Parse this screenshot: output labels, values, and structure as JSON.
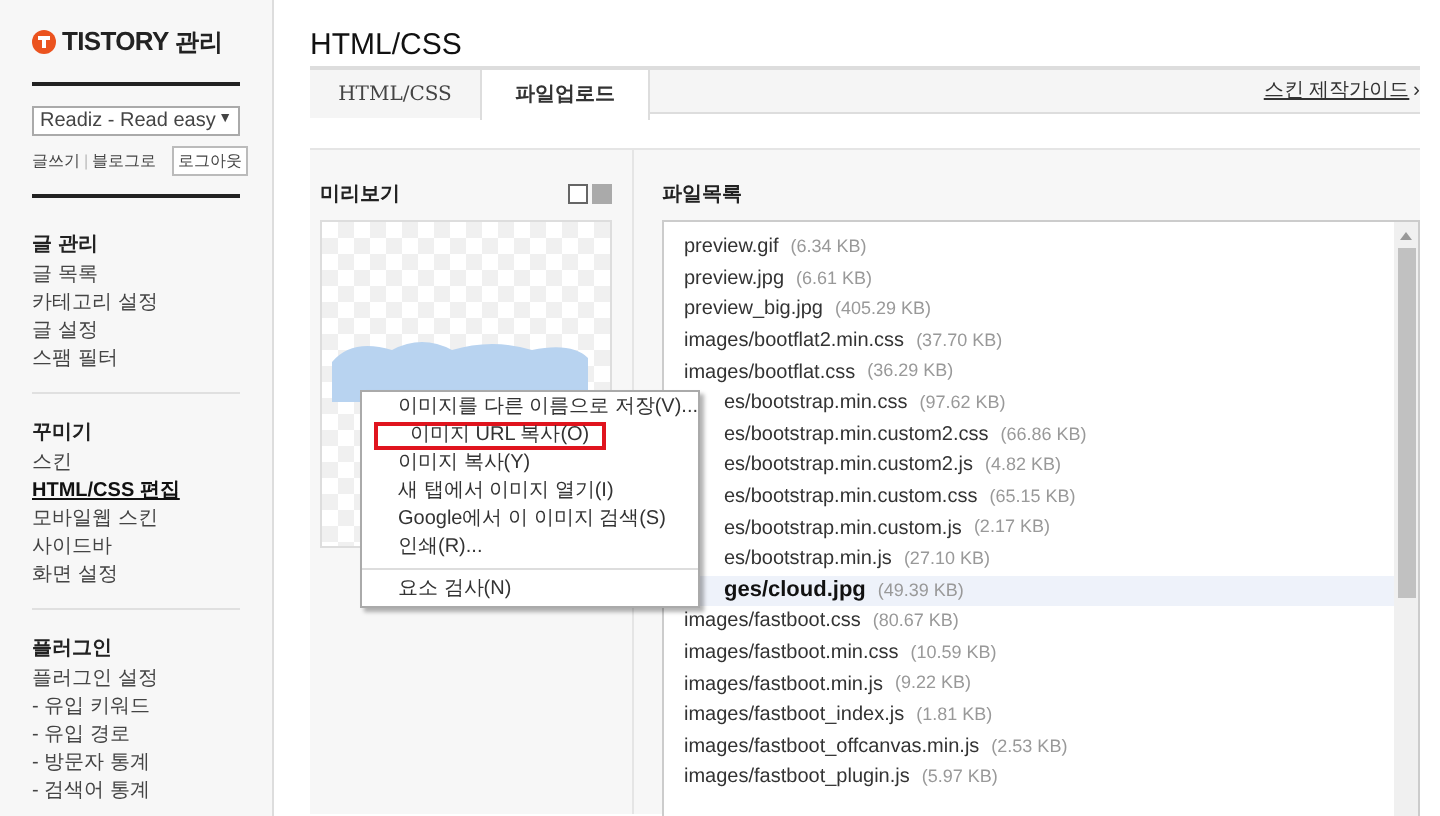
{
  "sidebar": {
    "logo": "TISTORY",
    "logo_suffix": "관리",
    "blog_select": "Readiz - Read easy",
    "select_arrow": "▼",
    "links": [
      "글쓰기",
      "블로그로"
    ],
    "link_separator": "|",
    "logout": "로그아웃",
    "sections": [
      {
        "heading": "글 관리",
        "items": [
          {
            "label": "글 목록",
            "selected": false
          },
          {
            "label": "카테고리 설정",
            "selected": false
          },
          {
            "label": "글 설정",
            "selected": false
          },
          {
            "label": "스팸 필터",
            "selected": false
          }
        ]
      },
      {
        "heading": "꾸미기",
        "items": [
          {
            "label": "스킨",
            "selected": false
          },
          {
            "label": "HTML/CSS 편집",
            "selected": true
          },
          {
            "label": "모바일웹 스킨",
            "selected": false
          },
          {
            "label": "사이드바",
            "selected": false
          },
          {
            "label": "화면 설정",
            "selected": false
          }
        ]
      },
      {
        "heading": "플러그인",
        "items": [
          {
            "label": "플러그인 설정",
            "selected": false
          },
          {
            "label": "- 유입 키워드",
            "selected": false
          },
          {
            "label": "- 유입 경로",
            "selected": false
          },
          {
            "label": "- 방문자 통계",
            "selected": false
          },
          {
            "label": "- 검색어 통계",
            "selected": false
          }
        ]
      }
    ]
  },
  "page_title": "HTML/CSS",
  "tabs": [
    {
      "label": "HTML/CSS",
      "selected": false
    },
    {
      "label": "파일업로드",
      "selected": true
    }
  ],
  "guide_link": "스킨 제작가이드",
  "guide_arrow": "›",
  "preview": {
    "title": "미리보기"
  },
  "file_list": {
    "title": "파일목록",
    "files": [
      {
        "name": "preview.gif",
        "size": "(6.34 KB)",
        "selected": false,
        "partial": false
      },
      {
        "name": "preview.jpg",
        "size": "(6.61 KB)",
        "selected": false,
        "partial": false
      },
      {
        "name": "preview_big.jpg",
        "size": "(405.29 KB)",
        "selected": false,
        "partial": false
      },
      {
        "name": "images/bootflat2.min.css",
        "size": "(37.70 KB)",
        "selected": false,
        "partial": false
      },
      {
        "name": "images/bootflat.css",
        "size": "(36.29 KB)",
        "selected": false,
        "partial": false
      },
      {
        "name": "es/bootstrap.min.css",
        "size": "(97.62 KB)",
        "selected": false,
        "partial": true
      },
      {
        "name": "es/bootstrap.min.custom2.css",
        "size": "(66.86 KB)",
        "selected": false,
        "partial": true
      },
      {
        "name": "es/bootstrap.min.custom2.js",
        "size": "(4.82 KB)",
        "selected": false,
        "partial": true
      },
      {
        "name": "es/bootstrap.min.custom.css",
        "size": "(65.15 KB)",
        "selected": false,
        "partial": true
      },
      {
        "name": "es/bootstrap.min.custom.js",
        "size": "(2.17 KB)",
        "selected": false,
        "partial": true
      },
      {
        "name": "es/bootstrap.min.js",
        "size": "(27.10 KB)",
        "selected": false,
        "partial": true
      },
      {
        "name": "ges/cloud.jpg",
        "size": "(49.39 KB)",
        "selected": true,
        "partial": true
      },
      {
        "name": "images/fastboot.css",
        "size": "(80.67 KB)",
        "selected": false,
        "partial": false
      },
      {
        "name": "images/fastboot.min.css",
        "size": "(10.59 KB)",
        "selected": false,
        "partial": false
      },
      {
        "name": "images/fastboot.min.js",
        "size": "(9.22 KB)",
        "selected": false,
        "partial": false
      },
      {
        "name": "images/fastboot_index.js",
        "size": "(1.81 KB)",
        "selected": false,
        "partial": false
      },
      {
        "name": "images/fastboot_offcanvas.min.js",
        "size": "(2.53 KB)",
        "selected": false,
        "partial": false
      },
      {
        "name": "images/fastboot_plugin.js",
        "size": "(5.97 KB)",
        "selected": false,
        "partial": false
      }
    ]
  },
  "context_menu": [
    {
      "kind": "item",
      "label": "이미지를 다른 이름으로 저장(V)...",
      "highlighted": false
    },
    {
      "kind": "item",
      "label": "이미지 URL 복사(O)",
      "highlighted": true
    },
    {
      "kind": "item",
      "label": "이미지 복사(Y)",
      "highlighted": false
    },
    {
      "kind": "item",
      "label": "새 탭에서 이미지 열기(I)",
      "highlighted": false
    },
    {
      "kind": "item",
      "label": "Google에서 이 이미지 검색(S)",
      "highlighted": false
    },
    {
      "kind": "item",
      "label": "인쇄(R)...",
      "highlighted": false
    },
    {
      "kind": "separator"
    },
    {
      "kind": "item",
      "label": "요소 검사(N)",
      "highlighted": false
    }
  ]
}
